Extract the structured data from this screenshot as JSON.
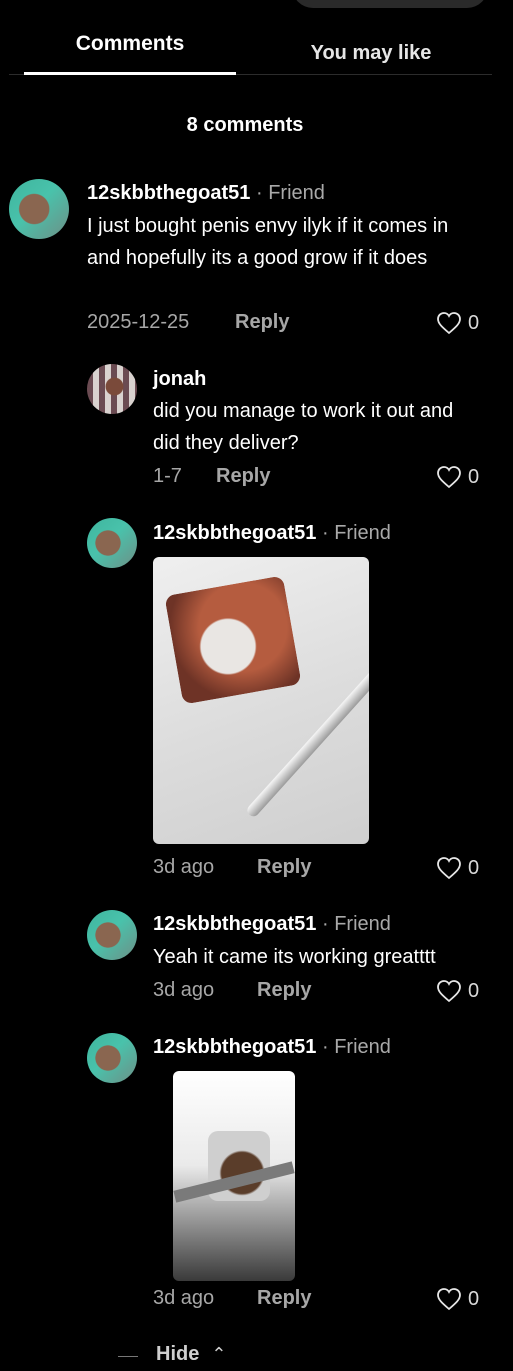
{
  "tabs": {
    "comments": "Comments",
    "you_may_like": "You may like"
  },
  "comment_count": "8 comments",
  "comments": [
    {
      "user": "12skbbthegoat51",
      "tag": "Friend",
      "text": "I just bought penis envy ilyk if it comes in and hopefully its a good grow if it does",
      "date": "2025-12-25",
      "reply": "Reply",
      "likes": "0"
    },
    {
      "user": "jonah",
      "text": "did you manage to work it out and did they deliver?",
      "date": "1-7",
      "reply": "Reply",
      "likes": "0"
    },
    {
      "user": "12skbbthegoat51",
      "tag": "Friend",
      "date": "3d ago",
      "reply": "Reply",
      "likes": "0"
    },
    {
      "user": "12skbbthegoat51",
      "tag": "Friend",
      "text": "Yeah it came its working greatttt",
      "date": "3d ago",
      "reply": "Reply",
      "likes": "0"
    },
    {
      "user": "12skbbthegoat51",
      "tag": "Friend",
      "date": "3d ago",
      "reply": "Reply",
      "likes": "0"
    }
  ],
  "sep": "·",
  "hide_label": "Hide",
  "icons": {
    "like": "heart-outline-icon",
    "chevron": "chevron-up-icon"
  },
  "colors": {
    "background": "#000000",
    "muted": "#a7a7a7",
    "text": "#ffffff"
  }
}
